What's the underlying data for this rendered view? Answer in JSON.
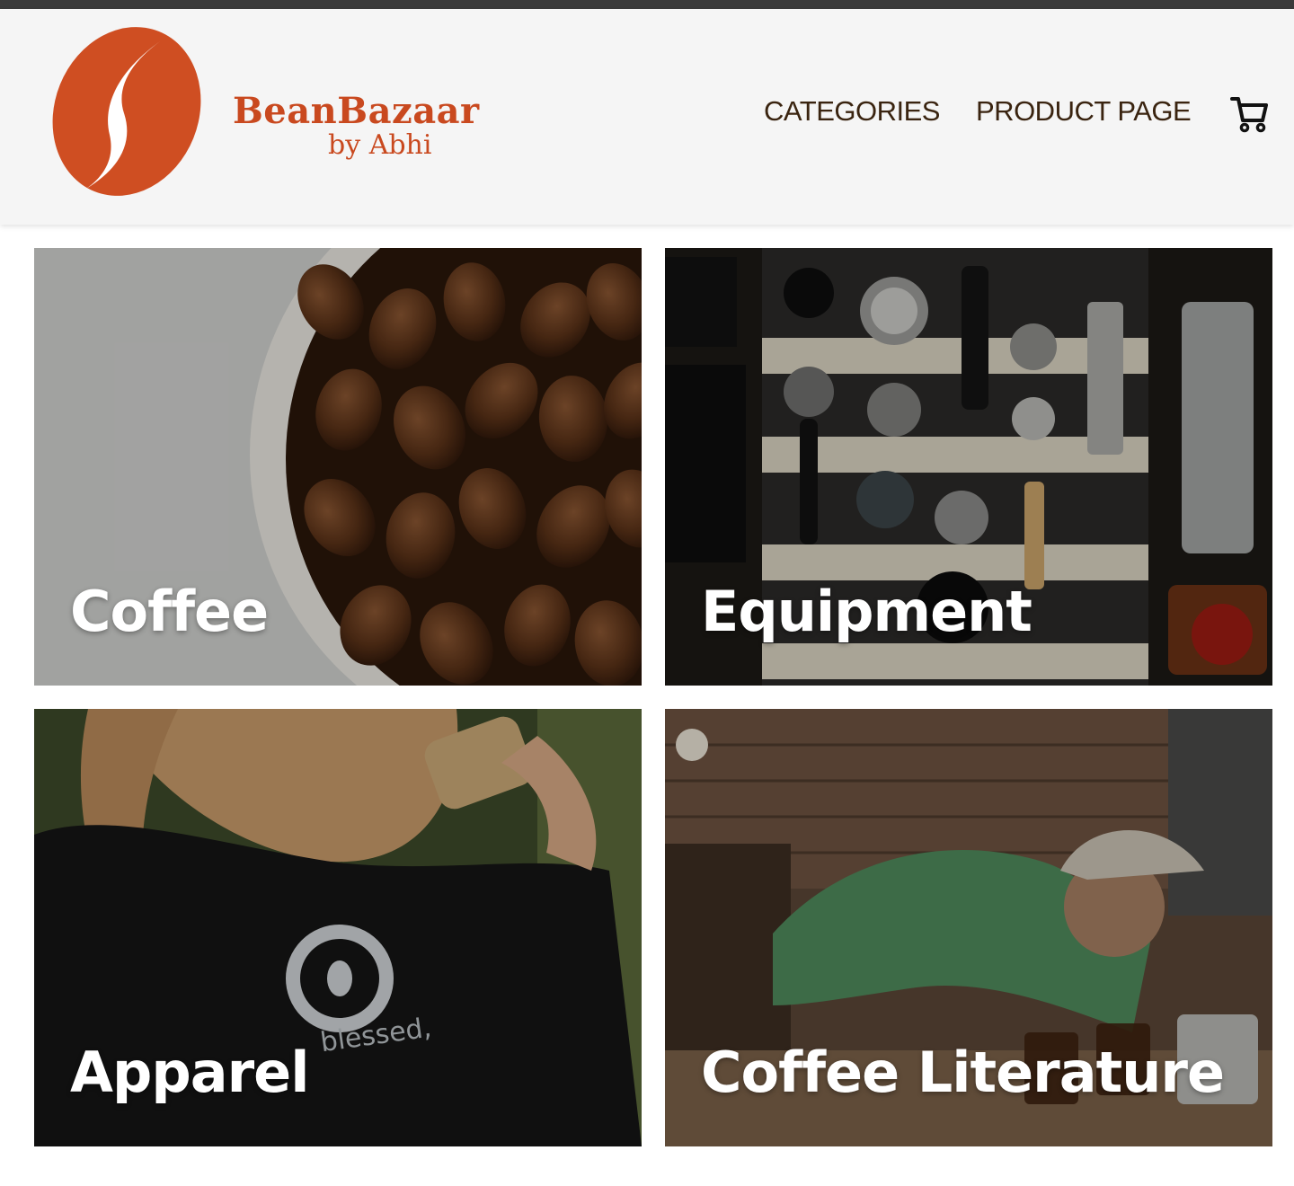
{
  "brand": {
    "name": "BeanBazaar",
    "subtitle": "by Abhi",
    "color": "#c9491f",
    "logo_icon": "coffee-bean-logo"
  },
  "nav": {
    "items": [
      {
        "label": "CATEGORIES"
      },
      {
        "label": "PRODUCT PAGE"
      }
    ],
    "cart_icon": "shopping-cart-icon"
  },
  "categories": [
    {
      "label": "Coffee",
      "image": "coffee beans in a white bowl"
    },
    {
      "label": "Equipment",
      "image": "espresso tools laid out on striped cloth"
    },
    {
      "label": "Apparel",
      "image": "person drinking coffee wearing printed t-shirt"
    },
    {
      "label": "Coffee Literature",
      "image": "barista cupping coffee in cafe"
    }
  ],
  "colors": {
    "nav_text": "#3a2410",
    "header_bg": "#f5f5f5"
  }
}
